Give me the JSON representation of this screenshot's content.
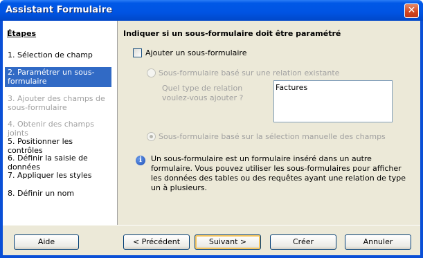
{
  "window": {
    "title": "Assistant Formulaire"
  },
  "sidebar": {
    "heading": "Étapes",
    "steps": [
      {
        "label": "1. Sélection de champ",
        "state": "normal"
      },
      {
        "label": "2. Paramétrer un sous-formulaire",
        "state": "active"
      },
      {
        "label": "3. Ajouter des champs de sous-formulaire",
        "state": "disabled"
      },
      {
        "label": "4. Obtenir des champs joints",
        "state": "disabled"
      },
      {
        "label": "5. Positionner les contrôles",
        "state": "normal"
      },
      {
        "label": "6. Définir la saisie de données",
        "state": "normal"
      },
      {
        "label": "7. Appliquer les styles",
        "state": "normal"
      },
      {
        "label": "8. Définir un nom",
        "state": "normal"
      }
    ]
  },
  "main": {
    "heading": "Indiquer si un sous-formulaire doit être paramétré",
    "add_subform_label": "Ajouter un sous-formulaire",
    "add_subform_checked": false,
    "radio_existing_label": "Sous-formulaire basé sur une relation existante",
    "relation_question": "Quel type de relation voulez-vous ajouter ?",
    "relation_list": [
      "Factures"
    ],
    "radio_manual_label": "Sous-formulaire basé sur la sélection manuelle des champs",
    "info_text": "Un sous-formulaire est un formulaire inséré dans un autre formulaire. Vous pouvez utiliser les sous-formulaires pour afficher les données des tables ou des requêtes ayant une relation de type un à plusieurs."
  },
  "buttons": {
    "help": "Aide",
    "previous": "< Précédent",
    "next": "Suivant >",
    "create": "Créer",
    "cancel": "Annuler"
  },
  "icons": {
    "close": "close-icon",
    "info": "info-icon"
  }
}
